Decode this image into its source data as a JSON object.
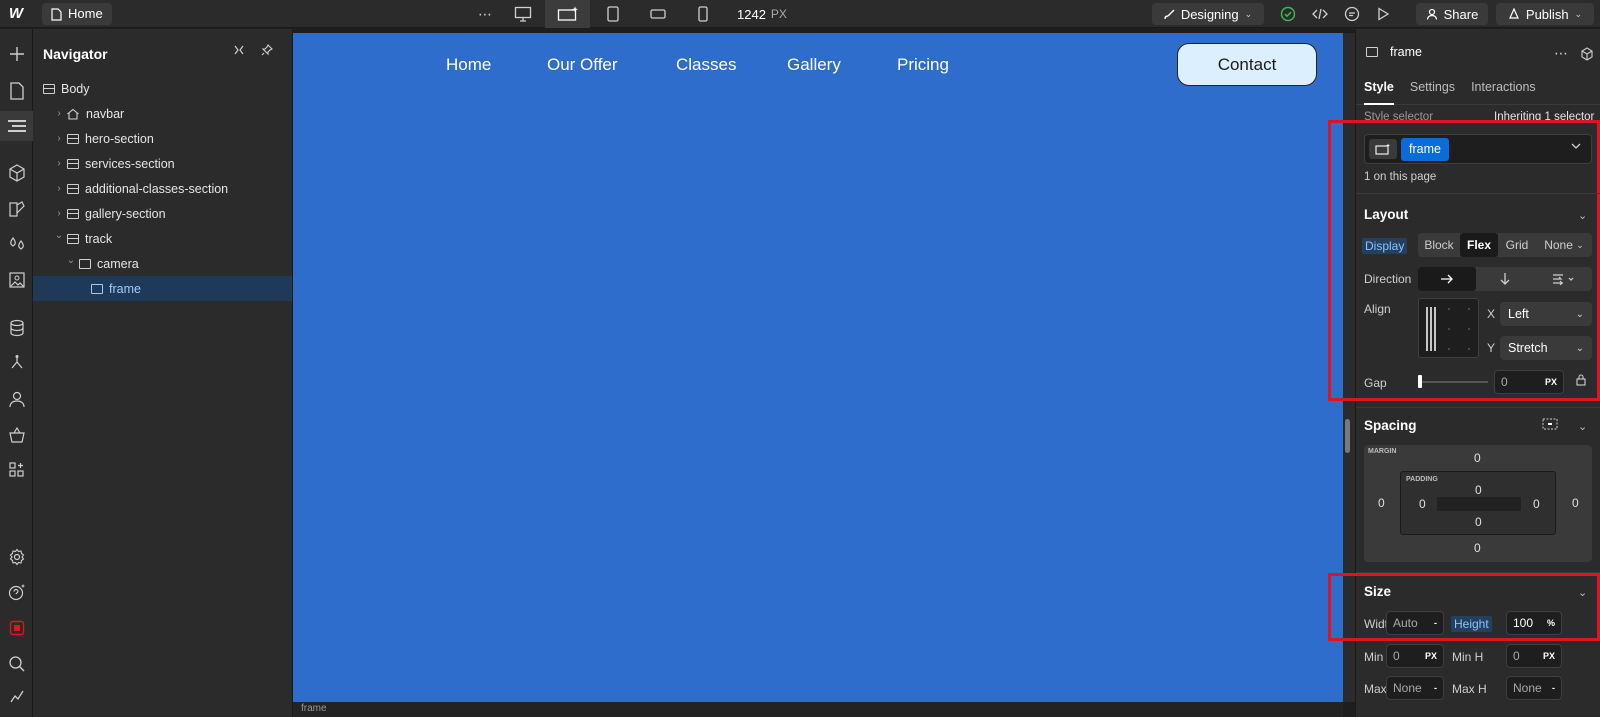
{
  "topbar": {
    "logo": "W",
    "home_label": "Home",
    "more": "⋯",
    "canvas_width": "1242",
    "canvas_unit": "PX",
    "mode_label": "Designing",
    "share_label": "Share",
    "publish_label": "Publish"
  },
  "navigator": {
    "title": "Navigator",
    "tree": [
      {
        "label": "Body",
        "depth": 0,
        "type": "body",
        "expand": ""
      },
      {
        "label": "navbar",
        "depth": 1,
        "type": "home",
        "expand": "right"
      },
      {
        "label": "hero-section",
        "depth": 1,
        "type": "section",
        "expand": "right"
      },
      {
        "label": "services-section",
        "depth": 1,
        "type": "section",
        "expand": "right"
      },
      {
        "label": "additional-classes-section",
        "depth": 1,
        "type": "section",
        "expand": "right"
      },
      {
        "label": "gallery-section",
        "depth": 1,
        "type": "section",
        "expand": "right"
      },
      {
        "label": "track",
        "depth": 1,
        "type": "section",
        "expand": "down"
      },
      {
        "label": "camera",
        "depth": 2,
        "type": "div",
        "expand": "down"
      },
      {
        "label": "frame",
        "depth": 3,
        "type": "div",
        "expand": "",
        "selected": true
      }
    ]
  },
  "canvas": {
    "nav_links": [
      "Home",
      "Our Offer",
      "Classes",
      "Gallery",
      "Pricing"
    ],
    "contact_label": "Contact",
    "background": "#2e6dcb",
    "breadcrumb": "frame"
  },
  "panel": {
    "selected_name": "frame",
    "tabs": [
      "Style",
      "Settings",
      "Interactions"
    ],
    "style_selector_label": "Style selector",
    "inheriting_label": "Inheriting 1 selector",
    "class_name": "frame",
    "on_page": "1 on this page",
    "layout": {
      "title": "Layout",
      "display_label": "Display",
      "display_options": [
        "Block",
        "Flex",
        "Grid",
        "None"
      ],
      "display_selected": "Flex",
      "direction_label": "Direction",
      "align_label": "Align",
      "x_label": "X",
      "x_value": "Left",
      "y_label": "Y",
      "y_value": "Stretch",
      "gap_label": "Gap",
      "gap_value": "0",
      "gap_unit": "PX"
    },
    "spacing": {
      "title": "Spacing",
      "margin_label": "MARGIN",
      "padding_label": "PADDING",
      "margin": {
        "top": "0",
        "right": "0",
        "bottom": "0",
        "left": "0"
      },
      "padding": {
        "top": "0",
        "right": "0",
        "bottom": "0",
        "left": "0"
      }
    },
    "size": {
      "title": "Size",
      "width_label": "Width",
      "width_value": "Auto",
      "width_unit": "-",
      "height_label": "Height",
      "height_value": "100",
      "height_unit": "%",
      "minw_label": "Min W",
      "minw_value": "0",
      "minw_unit": "PX",
      "minh_label": "Min H",
      "minh_value": "0",
      "minh_unit": "PX",
      "maxw_label": "Max W",
      "maxw_value": "None",
      "maxw_unit": "-",
      "maxh_label": "Max H",
      "maxh_value": "None",
      "maxh_unit": "-"
    }
  },
  "colors": {
    "accent": "#0b6bdb",
    "highlight": "#e0141e",
    "selected_row": "#1f3a59",
    "check_green": "#3fb950"
  }
}
